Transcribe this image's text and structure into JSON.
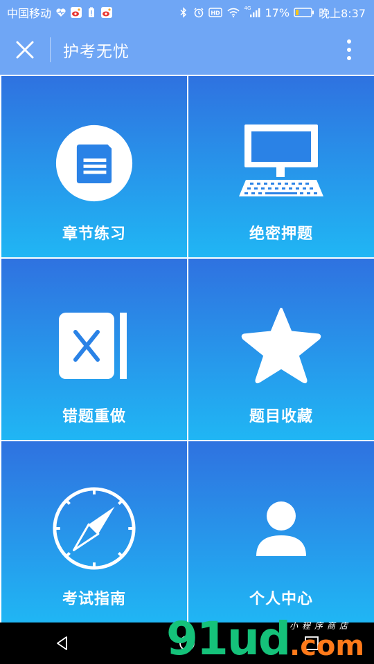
{
  "status_bar": {
    "carrier": "中国移动",
    "battery_percent": "17%",
    "time": "晚上8:37",
    "network_label": "4G",
    "hd_label": "HD"
  },
  "header": {
    "title": "护考无忧"
  },
  "tiles": [
    {
      "label": "章节练习",
      "icon": "document-icon"
    },
    {
      "label": "绝密押题",
      "icon": "computer-icon"
    },
    {
      "label": "错题重做",
      "icon": "wrong-book-icon"
    },
    {
      "label": "题目收藏",
      "icon": "star-icon"
    },
    {
      "label": "考试指南",
      "icon": "compass-icon"
    },
    {
      "label": "个人中心",
      "icon": "user-icon"
    }
  ],
  "watermark": {
    "main": "91ud",
    "suffix": ".com",
    "tagline": "小程序商店"
  },
  "colors": {
    "header": "#6fa6f5",
    "tile_top": "#2f72e0",
    "tile_bottom": "#20b6f4",
    "watermark_main": "#15c27a",
    "watermark_suffix": "#ff7a1a"
  }
}
